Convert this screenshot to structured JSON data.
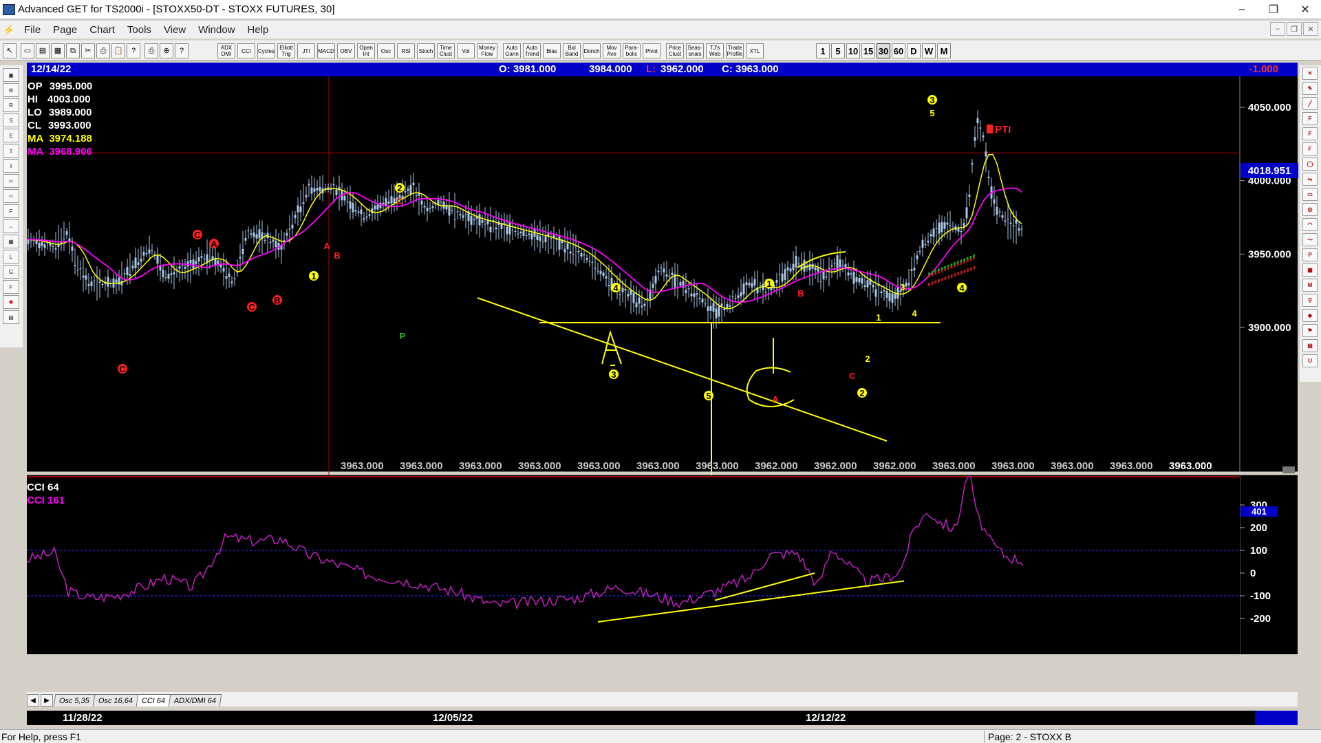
{
  "window": {
    "title": "Advanced GET for TS2000i - [STOXX50-DT - STOXX FUTURES, 30]",
    "controls": [
      "–",
      "❐",
      "✕"
    ]
  },
  "menu": [
    "File",
    "Page",
    "Chart",
    "Tools",
    "View",
    "Window",
    "Help"
  ],
  "toolbar": {
    "studies": [
      "ADX DMI",
      "CCI",
      "Cycles",
      "Elliott Trig",
      "JTI",
      "MACD",
      "OBV",
      "Open Int",
      "Osc",
      "RSI",
      "Stoch",
      "Time Clust",
      "Vol",
      "Money Flow",
      "Auto Gann",
      "Auto Trend",
      "Bias",
      "Bol Band",
      "Donch",
      "Mov Ave",
      "Para-bolic",
      "Pivot",
      "Price Clust",
      "Seas-onals",
      "TJ's Web",
      "Trade Profile",
      "XTL"
    ],
    "periods": [
      "1",
      "5",
      "10",
      "15",
      "30",
      "60",
      "D",
      "W",
      "M"
    ],
    "selected_period": "30"
  },
  "info_bar": {
    "date": "12/14/22",
    "open": "O: 3981.000",
    "high": "3984.000",
    "low": "L: 3962.000",
    "close": "C: 3963.000",
    "change": "-1.000"
  },
  "ohlc_panel": [
    {
      "label": "OP",
      "value": "3995.000",
      "color": "#ffffff"
    },
    {
      "label": "HI",
      "value": "4003.000",
      "color": "#ffffff"
    },
    {
      "label": "LO",
      "value": "3989.000",
      "color": "#ffffff"
    },
    {
      "label": "CL",
      "value": "3993.000",
      "color": "#ffffff"
    },
    {
      "label": "MA",
      "value": "3974.188",
      "color": "#ffff00"
    },
    {
      "label": "MA",
      "value": "3968.906",
      "color": "#ff00ff"
    }
  ],
  "price_axis": [
    "4050.000",
    "4000.000",
    "3950.000",
    "3900.000"
  ],
  "crosshair_price": "4018.951",
  "bottom_values": [
    "3963.000",
    "3963.000",
    "3963.000",
    "3963.000",
    "3963.000",
    "3963.000",
    "3963.000",
    "3962.000",
    "3962.000",
    "3962.000",
    "3963.000",
    "3963.000",
    "3963.000",
    "3963.000",
    "3963.000"
  ],
  "pti_label": "PTI",
  "cci_panel": {
    "label1": "CCI 64",
    "label2": "CCI  161",
    "axis": [
      "300",
      "200",
      "100",
      "0",
      "-100",
      "-200"
    ],
    "current": "401"
  },
  "tabs": [
    "Osc 5,35",
    "Osc 16,64",
    "CCI 64",
    "ADX/DMI 64"
  ],
  "active_tab": "CCI 64",
  "dates": [
    "11/28/22",
    "12/05/22",
    "12/12/22"
  ],
  "status": {
    "help": "For Help, press F1",
    "page": "Page: 2 - STOXX B"
  },
  "colors": {
    "ma_fast": "#ffff00",
    "ma_slow": "#ff00ff",
    "bars": "#a8c8e8",
    "label_red": "#ff2020",
    "label_yellow": "#ffff00",
    "cci": "#c020c0"
  }
}
